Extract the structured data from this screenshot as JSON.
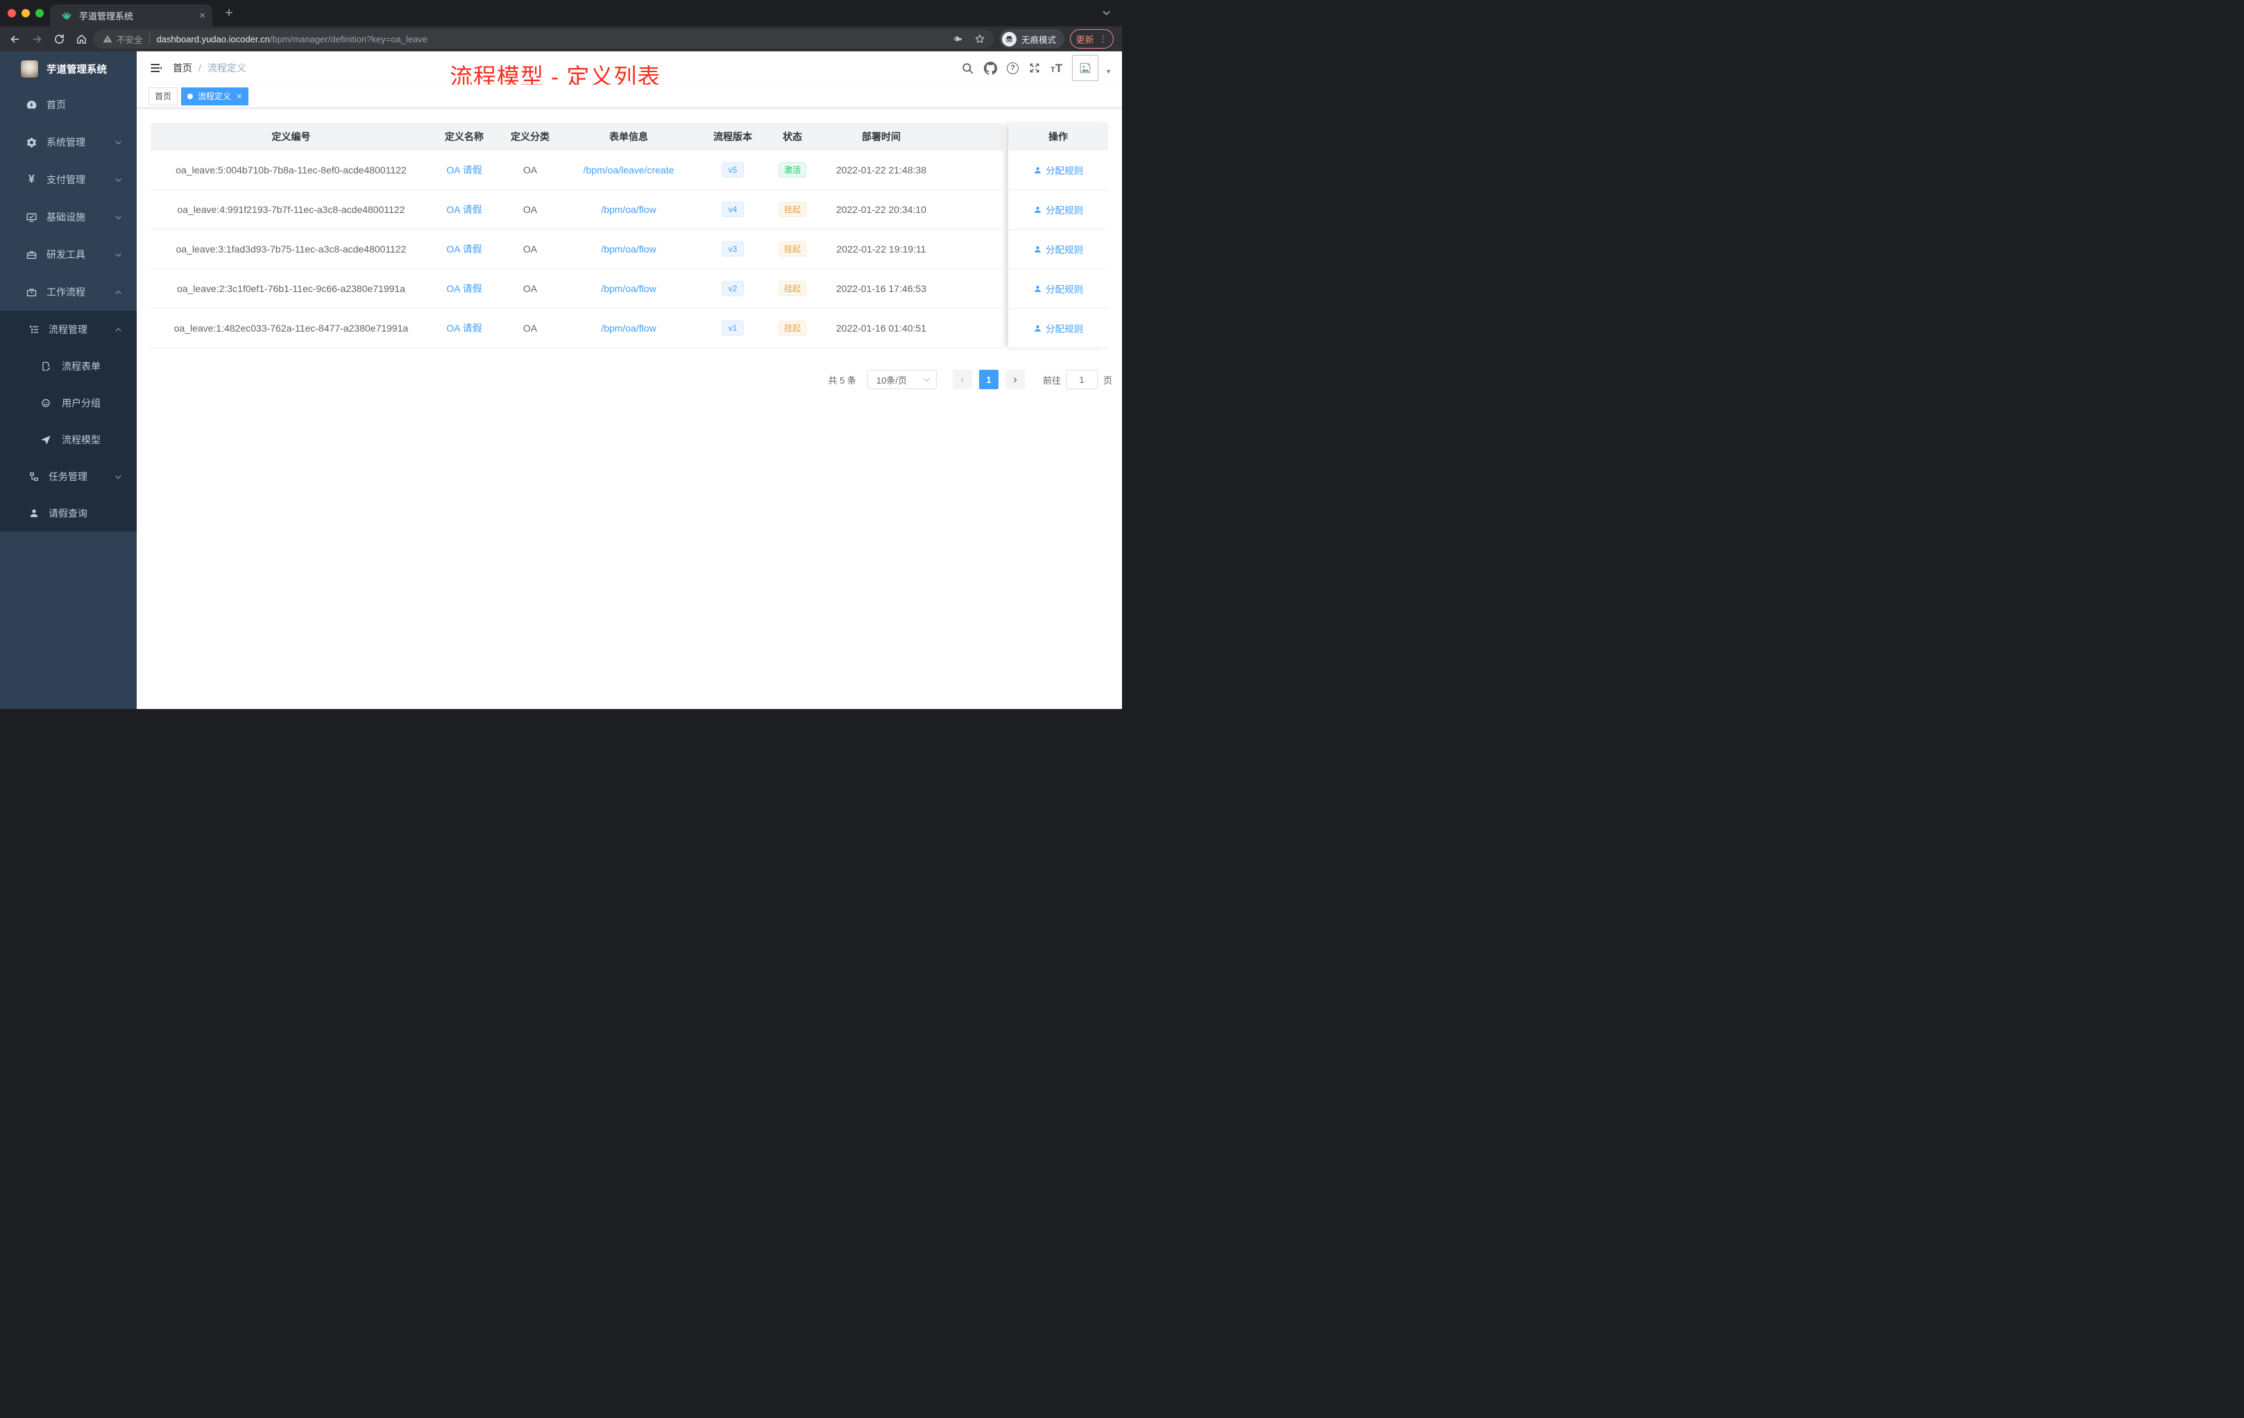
{
  "glyphs": {
    "close": "×",
    "plus": "+",
    "yen": "¥",
    "question": "?",
    "font_small": "T",
    "font_big": "T",
    "prev": "‹",
    "next": "›",
    "caret_down": "▼",
    "dots_vertical": "⋮"
  },
  "browser": {
    "tab": {
      "title": "芋道管理系统"
    },
    "toolbar": {
      "security_label": "不安全",
      "url_host": "dashboard.yudao.iocoder.cn",
      "url_path": "/bpm/manager/definition?key=oa_leave",
      "incognito_label": "无痕模式",
      "update_label": "更新"
    }
  },
  "sidebar": {
    "logo_title": "芋道管理系统",
    "items": [
      {
        "label": "首页"
      },
      {
        "label": "系统管理"
      },
      {
        "label": "支付管理"
      },
      {
        "label": "基础设施"
      },
      {
        "label": "研发工具"
      },
      {
        "label": "工作流程"
      }
    ],
    "submenu": {
      "title": {
        "label": "流程管理"
      },
      "children": [
        {
          "label": "流程表单"
        },
        {
          "label": "用户分组"
        },
        {
          "label": "流程模型"
        }
      ],
      "siblings": [
        {
          "label": "任务管理"
        },
        {
          "label": "请假查询"
        }
      ]
    }
  },
  "header": {
    "breadcrumb": {
      "home": "首页",
      "separator": "/",
      "current": "流程定义"
    },
    "annotation": "流程模型 - 定义列表"
  },
  "tags": {
    "home": {
      "label": "首页"
    },
    "active": {
      "label": "流程定义"
    }
  },
  "table": {
    "columns": [
      "定义编号",
      "定义名称",
      "定义分类",
      "表单信息",
      "流程版本",
      "状态",
      "部署时间",
      "操作"
    ],
    "action_label": "分配规则",
    "rows": [
      {
        "id": "oa_leave:5:004b710b-7b8a-11ec-8ef0-acde48001122",
        "name": "OA 请假",
        "category": "OA",
        "form": "/bpm/oa/leave/create",
        "version": "v5",
        "status": "激活",
        "status_type": "success",
        "deploy_time": "2022-01-22 21:48:38"
      },
      {
        "id": "oa_leave:4:991f2193-7b7f-11ec-a3c8-acde48001122",
        "name": "OA 请假",
        "category": "OA",
        "form": "/bpm/oa/flow",
        "version": "v4",
        "status": "挂起",
        "status_type": "warning",
        "deploy_time": "2022-01-22 20:34:10"
      },
      {
        "id": "oa_leave:3:1fad3d93-7b75-11ec-a3c8-acde48001122",
        "name": "OA 请假",
        "category": "OA",
        "form": "/bpm/oa/flow",
        "version": "v3",
        "status": "挂起",
        "status_type": "warning",
        "deploy_time": "2022-01-22 19:19:11"
      },
      {
        "id": "oa_leave:2:3c1f0ef1-76b1-11ec-9c66-a2380e71991a",
        "name": "OA 请假",
        "category": "OA",
        "form": "/bpm/oa/flow",
        "version": "v2",
        "status": "挂起",
        "status_type": "warning",
        "deploy_time": "2022-01-16 17:46:53"
      },
      {
        "id": "oa_leave:1:482ec033-762a-11ec-8477-a2380e71991a",
        "name": "OA 请假",
        "category": "OA",
        "form": "/bpm/oa/flow",
        "version": "v1",
        "status": "挂起",
        "status_type": "warning",
        "deploy_time": "2022-01-16 01:40:51"
      }
    ]
  },
  "pagination": {
    "total": "共 5 条",
    "page_size": "10条/页",
    "page": "1",
    "goto_label": "前往",
    "goto_value": "1",
    "unit_label": "页"
  },
  "colors": {
    "primary": "#409eff",
    "success": "#13ce66",
    "warning": "#e6a23c",
    "annotation_red": "#fb2f1d",
    "sidebar_bg": "#304156",
    "submenu_bg": "#1f2d3d",
    "tab_active_bg": "#409eff"
  }
}
